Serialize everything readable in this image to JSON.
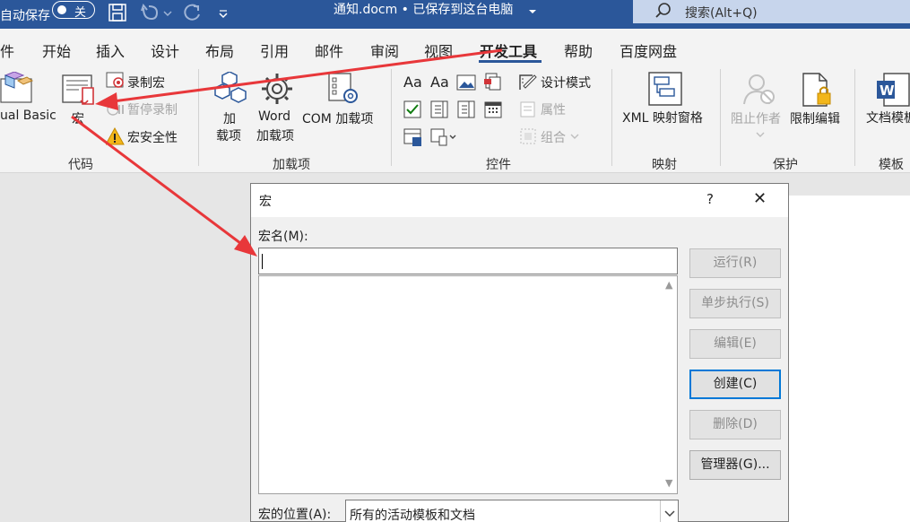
{
  "titlebar": {
    "autosave_label": "自动保存",
    "autosave_state": "关",
    "doc_title": "通知.docm • 已保存到这台电脑",
    "search_placeholder": "搜索(Alt+Q)"
  },
  "tabs": [
    "件",
    "开始",
    "插入",
    "设计",
    "布局",
    "引用",
    "邮件",
    "审阅",
    "视图",
    "开发工具",
    "帮助",
    "百度网盘"
  ],
  "active_tab": "开发工具",
  "ribbon": {
    "code": {
      "vb_label": "ual Basic",
      "macro_label": "宏",
      "record_label": "录制宏",
      "pause_label": "暂停录制",
      "security_label": "宏安全性",
      "group_label": "代码"
    },
    "addins": {
      "addin_line1": "加",
      "addin_line2": "载项",
      "word_line1": "Word",
      "word_line2": "加载项",
      "com_label": "COM 加载项",
      "group_label": "加载项"
    },
    "controls": {
      "design_mode_label": "设计模式",
      "properties_label": "属性",
      "group_label_item": "组合",
      "group_label": "控件"
    },
    "mapping": {
      "xml_label": "XML 映射窗格",
      "group_label": "映射"
    },
    "protect": {
      "block_label": "阻止作者",
      "restrict_label": "限制编辑",
      "group_label": "保护"
    },
    "templates": {
      "doc_template_label": "文档模板",
      "group_label": "模板"
    }
  },
  "dialog": {
    "title": "宏",
    "help": "?",
    "close": "✕",
    "macro_name_label": "宏名(M):",
    "macro_name_value": "",
    "buttons": {
      "run": "运行(R)",
      "step": "单步执行(S)",
      "edit": "编辑(E)",
      "create": "创建(C)",
      "delete": "删除(D)",
      "organizer": "管理器(G)..."
    },
    "location_label": "宏的位置(A):",
    "location_value": "所有的活动模板和文档"
  },
  "annotation_color": "#e8373a",
  "accent_color": "#2b579a"
}
